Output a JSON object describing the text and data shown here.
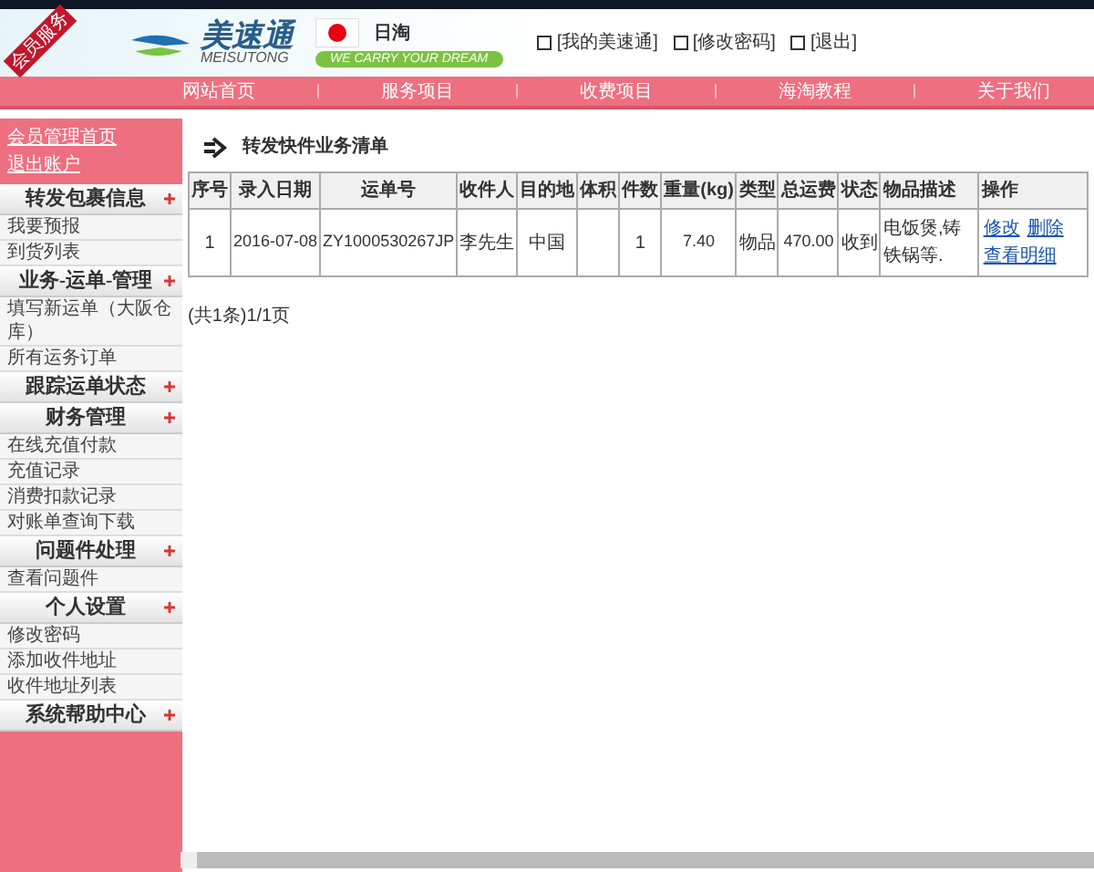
{
  "corner_ribbon": "会员服务",
  "header": {
    "logo_text": "美速通",
    "logo_subtext": "MEISUTONG",
    "region": "日淘",
    "slogan": "WE CARRY YOUR DREAM",
    "links": [
      "[我的美速通]",
      "[修改密码]",
      "[退出]"
    ]
  },
  "nav": [
    "网站首页",
    "服务项目",
    "收费项目",
    "海淘教程",
    "关于我们"
  ],
  "sidebar": {
    "top_links": [
      "会员管理首页",
      "退出账户"
    ],
    "sections": [
      {
        "title": "转发包裹信息",
        "items": [
          "我要预报",
          "到货列表"
        ]
      },
      {
        "title": "业务-运单-管理",
        "items": [
          "填写新运单（大阪仓库）",
          "所有运务订单"
        ]
      },
      {
        "title": "跟踪运单状态"
      },
      {
        "title": "财务管理",
        "items": [
          "在线充值付款",
          "充值记录",
          "消费扣款记录",
          "对账单查询下载"
        ]
      },
      {
        "title": "问题件处理",
        "items": [
          "查看问题件"
        ]
      },
      {
        "title": "个人设置",
        "items": [
          "修改密码",
          "添加收件地址",
          "收件地址列表"
        ]
      },
      {
        "title": "系统帮助中心"
      }
    ]
  },
  "page_title": "转发快件业务清单",
  "table": {
    "columns": [
      "序号",
      "录入日期",
      "运单号",
      "收件人",
      "目的地",
      "体积",
      "件数",
      "重量(kg)",
      "类型",
      "总运费",
      "状态",
      "物品描述",
      "操作"
    ],
    "rows": [
      {
        "cells": [
          "1",
          "2016-07-08",
          "ZY1000530267JP",
          "李先生",
          "中国",
          "",
          "1",
          "7.40",
          "物品",
          "470.00",
          "收到",
          "电饭煲,铸铁锅等."
        ],
        "actions": [
          "修改",
          "删除",
          "查看明细"
        ]
      }
    ]
  },
  "pagination": "(共1条)1/1页"
}
